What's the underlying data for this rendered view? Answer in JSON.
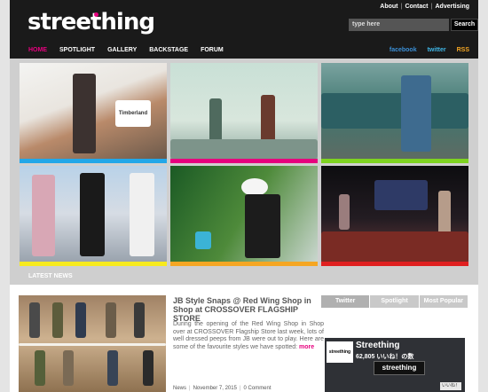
{
  "brand": {
    "logo_text": "streething",
    "accent": "#e6007e"
  },
  "top_links": [
    "About",
    "Contact",
    "Advertising"
  ],
  "search": {
    "placeholder": "type here",
    "button": "Search"
  },
  "nav": {
    "items": [
      "HOME",
      "SPOTLIGHT",
      "GALLERY",
      "BACKSTAGE",
      "FORUM"
    ],
    "active": "HOME"
  },
  "social": {
    "facebook": "facebook",
    "twitter": "twitter",
    "rss": "RSS",
    "colors": {
      "facebook": "#3b8fd6",
      "twitter": "#3fb6e6",
      "rss": "#f5a623"
    }
  },
  "gallery": {
    "tiles": [
      {
        "caption": "Timberland",
        "bar_color": "#22a7e8"
      },
      {
        "caption": "",
        "bar_color": "#e6007e"
      },
      {
        "caption": "",
        "bar_color": "#7ed321"
      },
      {
        "caption": "",
        "bar_color": "#f7ea1e"
      },
      {
        "caption": "",
        "bar_color": "#f5a623"
      },
      {
        "caption": "",
        "bar_color": "#e02020"
      }
    ]
  },
  "latest_news": {
    "heading": "LATEST NEWS",
    "article": {
      "title": "JB Style Snaps @ Red Wing Shop in Shop at CROSSOVER FLAGSHIP STORE",
      "body": "During the opening of the Red Wing Shop in Shop over at CROSSOVER Flagship Store last week, lots of well dressed peeps from JB were out to play. Here are some of the favourite styles we have spotted:",
      "more": "more",
      "category": "News",
      "date": "November 7, 2015",
      "comments": "0 Comment"
    }
  },
  "widget": {
    "tabs": [
      "Twitter",
      "Spotlight",
      "Most Popular"
    ],
    "active_tab": "Twitter",
    "facebook_box": {
      "name": "Streething",
      "likes": "62,805 いいね！の数",
      "banner": "streething",
      "logo_text": "streething",
      "like_button": "いいね！"
    }
  }
}
